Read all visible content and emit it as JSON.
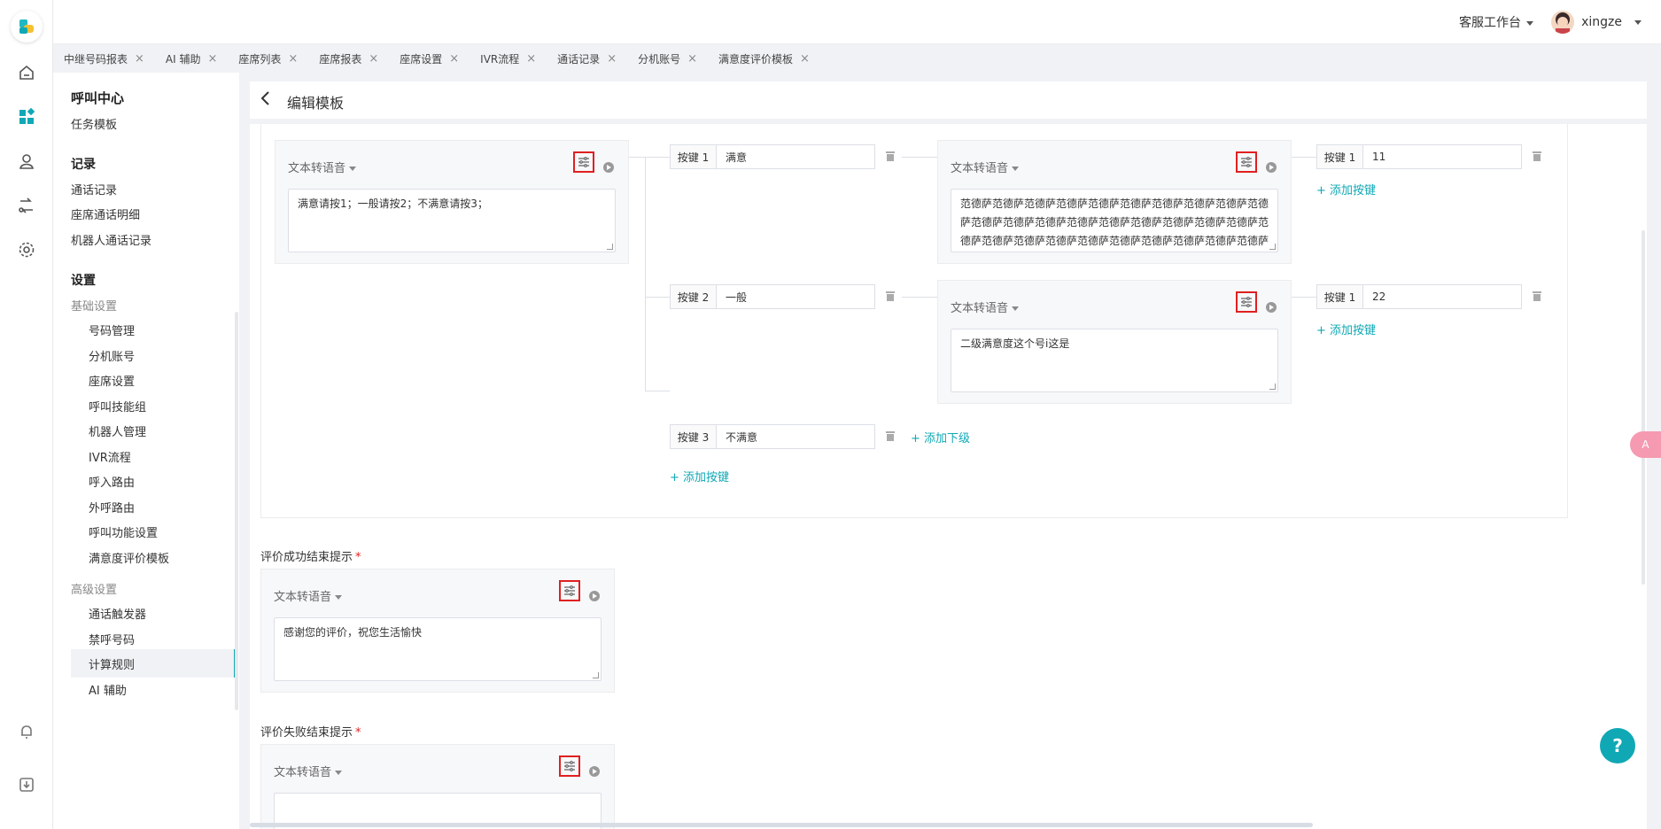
{
  "topbar": {
    "workbench": "客服工作台",
    "username": "xingze"
  },
  "tabs": [
    "中继号码报表",
    "AI 辅助",
    "座席列表",
    "座席报表",
    "座席设置",
    "IVR流程",
    "通话记录",
    "分机账号",
    "满意度评价模板"
  ],
  "sidebar": {
    "title": "呼叫中心",
    "task_template": "任务模板",
    "group_records": "记录",
    "records": [
      "通话记录",
      "座席通话明细",
      "机器人通话记录"
    ],
    "group_settings": "设置",
    "basic_settings": "基础设置",
    "basic_items": [
      "号码管理",
      "分机账号",
      "座席设置",
      "呼叫技能组",
      "机器人管理",
      "IVR流程",
      "呼入路由",
      "外呼路由",
      "呼叫功能设置",
      "满意度评价模板"
    ],
    "advanced_settings": "高级设置",
    "advanced_items": [
      "通话触发器",
      "禁呼号码",
      "计算规则",
      "AI 辅助"
    ]
  },
  "page": {
    "title": "编辑模板"
  },
  "tts_label": "文本转语音",
  "root_node": {
    "text": "满意请按1；一般请按2；不满意请按3；"
  },
  "keys": [
    {
      "label": "按键 1",
      "value": "满意"
    },
    {
      "label": "按键 2",
      "value": "一般"
    },
    {
      "label": "按键 3",
      "value": "不满意"
    }
  ],
  "sub_nodes": [
    {
      "text": "范德萨范德萨范德萨范德萨范德萨范德萨范德萨范德萨范德萨范德萨范德萨范德萨范德萨范德萨范德萨范德萨范德萨范德萨范德萨范德萨范德萨范德萨范德萨范德萨范德萨范德萨范德萨范德萨范德萨范德萨范德萨范德萨范德萨"
    },
    {
      "text": "二级满意度这个号i这是"
    }
  ],
  "sub_keys": [
    {
      "label": "按键 1",
      "value": "11"
    },
    {
      "label": "按键 1",
      "value": "22"
    }
  ],
  "actions": {
    "add_key": "添加按键",
    "add_child": "添加下级"
  },
  "success": {
    "label": "评价成功结束提示",
    "text": "感谢您的评价，祝您生活愉快"
  },
  "fail": {
    "label": "评价失败结束提示"
  },
  "required_mark": "*",
  "translate_label": "A"
}
